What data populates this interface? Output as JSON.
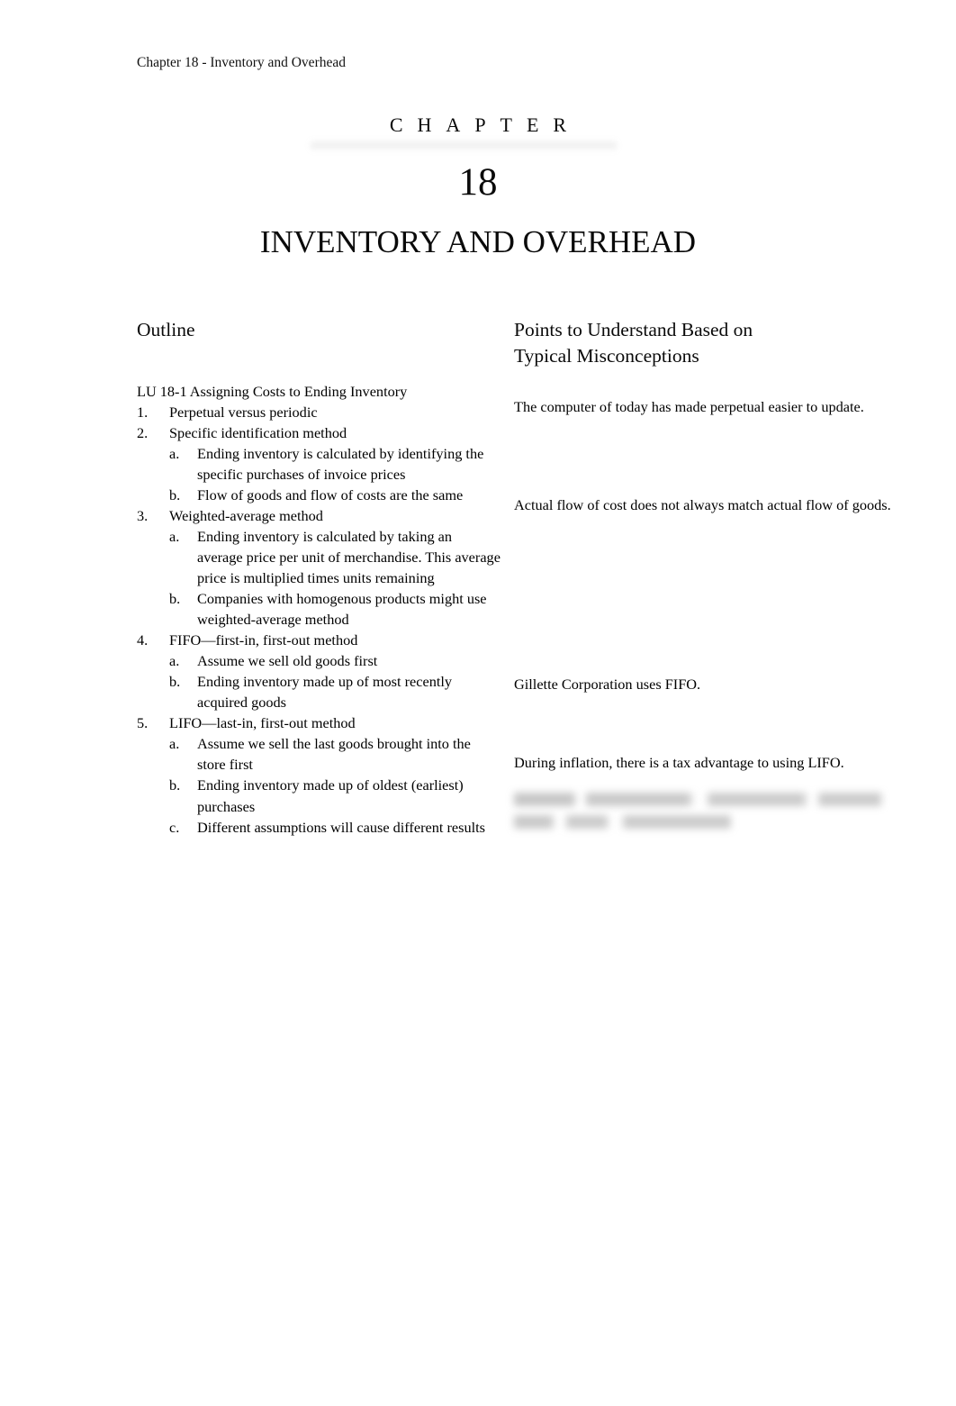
{
  "document": {
    "running_header": "Chapter 18 - Inventory and Overhead",
    "chapter_word": "CHAPTER",
    "chapter_number": "18",
    "chapter_title": "INVENTORY AND OVERHEAD",
    "page_number": ""
  },
  "outline": {
    "heading": "Outline",
    "lu_line": "LU 18-1  Assigning Costs to Ending Inventory",
    "items": [
      {
        "marker": "1.",
        "text": "Perpetual versus periodic",
        "subitems": []
      },
      {
        "marker": "2.",
        "text": "Specific identification method",
        "subitems": [
          {
            "marker": "a.",
            "text": "Ending inventory is calculated by identifying the specific purchases of invoice prices"
          },
          {
            "marker": "b.",
            "text": "Flow of goods and flow of costs are the same"
          }
        ]
      },
      {
        "marker": "3.",
        "text": "Weighted-average method",
        "subitems": [
          {
            "marker": "a.",
            "text": "Ending inventory is calculated by taking an average price per unit of merchandise. This average price is multiplied times units remaining"
          },
          {
            "marker": "b.",
            "text": "Companies with homogenous products might use weighted-average method"
          }
        ]
      },
      {
        "marker": "4.",
        "text": "FIFO—first-in, first-out method",
        "subitems": [
          {
            "marker": "a.",
            "text": "Assume we sell old goods first"
          },
          {
            "marker": "b.",
            "text": "Ending inventory made up of most recently acquired goods"
          }
        ]
      },
      {
        "marker": "5.",
        "text": "LIFO—last-in, first-out method",
        "subitems": [
          {
            "marker": "a.",
            "text": "Assume we sell the last goods brought into the store first"
          },
          {
            "marker": "b.",
            "text": "Ending inventory made up of oldest (earliest) purchases"
          },
          {
            "marker": "c.",
            "text": "Different assumptions will cause different results"
          }
        ]
      }
    ]
  },
  "points": {
    "heading_line_1": "Points to Understand Based on",
    "heading_line_2": "Typical Misconceptions",
    "notes": [
      "The computer of today has made perpetual easier to update.",
      "Actual flow of cost does not always match actual flow of goods.",
      "Gillette Corporation uses FIFO.",
      "During inflation, there is a tax advantage to using LIFO."
    ],
    "redacted_note": ""
  }
}
